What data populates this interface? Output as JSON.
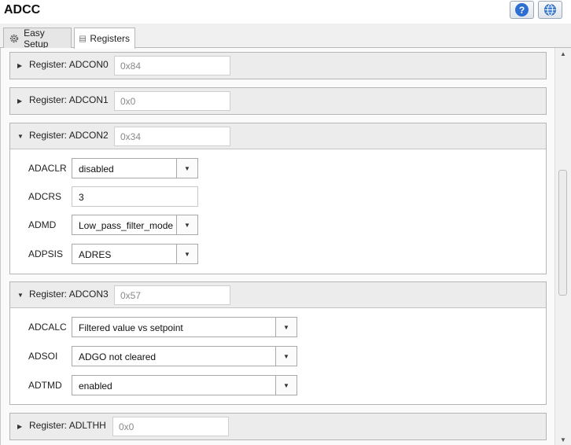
{
  "app": {
    "title": "ADCC"
  },
  "header": {
    "help_icon": "question-icon",
    "globe_icon": "globe-icon",
    "help_glyph": "?"
  },
  "tabs": [
    {
      "label": "Easy Setup",
      "icon": "gear-icon",
      "active": false
    },
    {
      "label": "Registers",
      "icon": "list-icon",
      "active": true
    }
  ],
  "registers": [
    {
      "label": "Register: ADCON0",
      "value": "0x84",
      "expanded": false
    },
    {
      "label": "Register: ADCON1",
      "value": "0x0",
      "expanded": false
    },
    {
      "label": "Register: ADCON2",
      "value": "0x34",
      "expanded": true,
      "fields": [
        {
          "name": "ADACLR",
          "type": "combo",
          "value": "disabled"
        },
        {
          "name": "ADCRS",
          "type": "text",
          "value": "3"
        },
        {
          "name": "ADMD",
          "type": "combo",
          "value": "Low_pass_filter_mode"
        },
        {
          "name": "ADPSIS",
          "type": "combo",
          "value": "ADRES"
        }
      ]
    },
    {
      "label": "Register: ADCON3",
      "value": "0x57",
      "expanded": true,
      "fields": [
        {
          "name": "ADCALC",
          "type": "combo",
          "value": "Filtered value vs setpoint"
        },
        {
          "name": "ADSOI",
          "type": "combo",
          "value": "ADGO not cleared"
        },
        {
          "name": "ADTMD",
          "type": "combo",
          "value": "enabled"
        }
      ]
    },
    {
      "label": "Register: ADLTHH",
      "value": "0x0",
      "expanded": false
    }
  ]
}
